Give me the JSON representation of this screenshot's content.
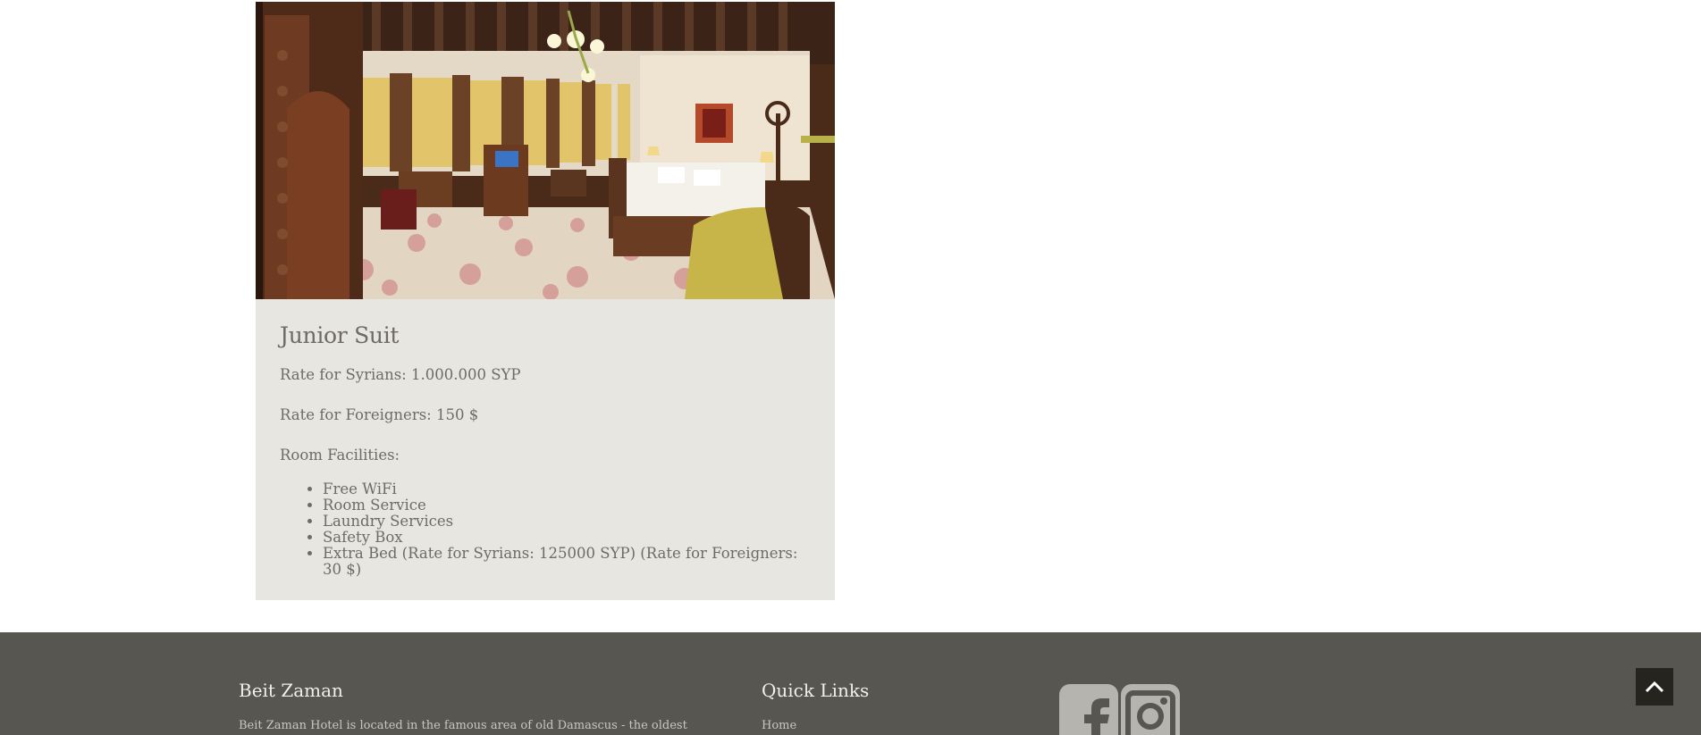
{
  "room": {
    "image_alt": "Junior Suit room photo",
    "title": "Junior Suit",
    "rate_syrians": "Rate for Syrians: 1.000.000 SYP",
    "rate_foreigners": "Rate for Foreigners: 150 $",
    "facilities_label": "Room Facilities:",
    "facilities": [
      "Free WiFi",
      "Room Service",
      "Laundry Services",
      "Safety Box",
      "Extra Bed (Rate for Syrians: 125000 SYP) (Rate for Foreigners: 30 $)"
    ]
  },
  "footer": {
    "about_title": "Beit Zaman",
    "about_text": "Beit Zaman Hotel is located in the famous area of old Damascus - the oldest",
    "links_title": "Quick Links",
    "links": [
      "Home"
    ],
    "social": [
      {
        "icon": "facebook-icon"
      },
      {
        "icon": "instagram-icon"
      }
    ]
  },
  "colors": {
    "card_bg": "#e8e6e1",
    "footer_bg": "#575651",
    "back_to_top_bg": "#25241f"
  }
}
